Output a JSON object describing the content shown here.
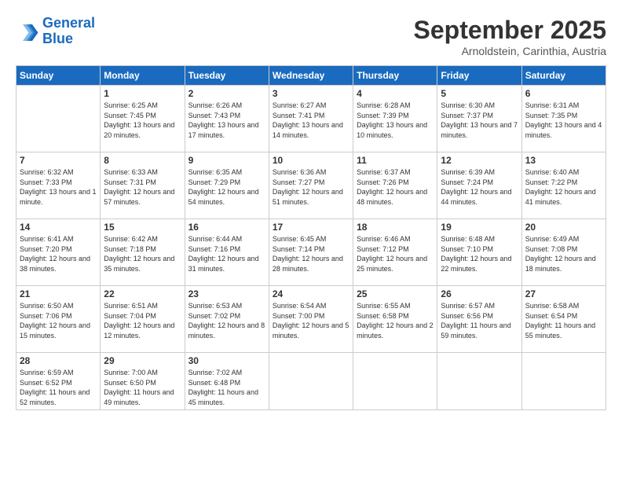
{
  "header": {
    "logo_line1": "General",
    "logo_line2": "Blue",
    "month": "September 2025",
    "location": "Arnoldstein, Carinthia, Austria"
  },
  "weekdays": [
    "Sunday",
    "Monday",
    "Tuesday",
    "Wednesday",
    "Thursday",
    "Friday",
    "Saturday"
  ],
  "weeks": [
    [
      {
        "day": "",
        "sunrise": "",
        "sunset": "",
        "daylight": ""
      },
      {
        "day": "1",
        "sunrise": "Sunrise: 6:25 AM",
        "sunset": "Sunset: 7:45 PM",
        "daylight": "Daylight: 13 hours and 20 minutes."
      },
      {
        "day": "2",
        "sunrise": "Sunrise: 6:26 AM",
        "sunset": "Sunset: 7:43 PM",
        "daylight": "Daylight: 13 hours and 17 minutes."
      },
      {
        "day": "3",
        "sunrise": "Sunrise: 6:27 AM",
        "sunset": "Sunset: 7:41 PM",
        "daylight": "Daylight: 13 hours and 14 minutes."
      },
      {
        "day": "4",
        "sunrise": "Sunrise: 6:28 AM",
        "sunset": "Sunset: 7:39 PM",
        "daylight": "Daylight: 13 hours and 10 minutes."
      },
      {
        "day": "5",
        "sunrise": "Sunrise: 6:30 AM",
        "sunset": "Sunset: 7:37 PM",
        "daylight": "Daylight: 13 hours and 7 minutes."
      },
      {
        "day": "6",
        "sunrise": "Sunrise: 6:31 AM",
        "sunset": "Sunset: 7:35 PM",
        "daylight": "Daylight: 13 hours and 4 minutes."
      }
    ],
    [
      {
        "day": "7",
        "sunrise": "Sunrise: 6:32 AM",
        "sunset": "Sunset: 7:33 PM",
        "daylight": "Daylight: 13 hours and 1 minute."
      },
      {
        "day": "8",
        "sunrise": "Sunrise: 6:33 AM",
        "sunset": "Sunset: 7:31 PM",
        "daylight": "Daylight: 12 hours and 57 minutes."
      },
      {
        "day": "9",
        "sunrise": "Sunrise: 6:35 AM",
        "sunset": "Sunset: 7:29 PM",
        "daylight": "Daylight: 12 hours and 54 minutes."
      },
      {
        "day": "10",
        "sunrise": "Sunrise: 6:36 AM",
        "sunset": "Sunset: 7:27 PM",
        "daylight": "Daylight: 12 hours and 51 minutes."
      },
      {
        "day": "11",
        "sunrise": "Sunrise: 6:37 AM",
        "sunset": "Sunset: 7:26 PM",
        "daylight": "Daylight: 12 hours and 48 minutes."
      },
      {
        "day": "12",
        "sunrise": "Sunrise: 6:39 AM",
        "sunset": "Sunset: 7:24 PM",
        "daylight": "Daylight: 12 hours and 44 minutes."
      },
      {
        "day": "13",
        "sunrise": "Sunrise: 6:40 AM",
        "sunset": "Sunset: 7:22 PM",
        "daylight": "Daylight: 12 hours and 41 minutes."
      }
    ],
    [
      {
        "day": "14",
        "sunrise": "Sunrise: 6:41 AM",
        "sunset": "Sunset: 7:20 PM",
        "daylight": "Daylight: 12 hours and 38 minutes."
      },
      {
        "day": "15",
        "sunrise": "Sunrise: 6:42 AM",
        "sunset": "Sunset: 7:18 PM",
        "daylight": "Daylight: 12 hours and 35 minutes."
      },
      {
        "day": "16",
        "sunrise": "Sunrise: 6:44 AM",
        "sunset": "Sunset: 7:16 PM",
        "daylight": "Daylight: 12 hours and 31 minutes."
      },
      {
        "day": "17",
        "sunrise": "Sunrise: 6:45 AM",
        "sunset": "Sunset: 7:14 PM",
        "daylight": "Daylight: 12 hours and 28 minutes."
      },
      {
        "day": "18",
        "sunrise": "Sunrise: 6:46 AM",
        "sunset": "Sunset: 7:12 PM",
        "daylight": "Daylight: 12 hours and 25 minutes."
      },
      {
        "day": "19",
        "sunrise": "Sunrise: 6:48 AM",
        "sunset": "Sunset: 7:10 PM",
        "daylight": "Daylight: 12 hours and 22 minutes."
      },
      {
        "day": "20",
        "sunrise": "Sunrise: 6:49 AM",
        "sunset": "Sunset: 7:08 PM",
        "daylight": "Daylight: 12 hours and 18 minutes."
      }
    ],
    [
      {
        "day": "21",
        "sunrise": "Sunrise: 6:50 AM",
        "sunset": "Sunset: 7:06 PM",
        "daylight": "Daylight: 12 hours and 15 minutes."
      },
      {
        "day": "22",
        "sunrise": "Sunrise: 6:51 AM",
        "sunset": "Sunset: 7:04 PM",
        "daylight": "Daylight: 12 hours and 12 minutes."
      },
      {
        "day": "23",
        "sunrise": "Sunrise: 6:53 AM",
        "sunset": "Sunset: 7:02 PM",
        "daylight": "Daylight: 12 hours and 8 minutes."
      },
      {
        "day": "24",
        "sunrise": "Sunrise: 6:54 AM",
        "sunset": "Sunset: 7:00 PM",
        "daylight": "Daylight: 12 hours and 5 minutes."
      },
      {
        "day": "25",
        "sunrise": "Sunrise: 6:55 AM",
        "sunset": "Sunset: 6:58 PM",
        "daylight": "Daylight: 12 hours and 2 minutes."
      },
      {
        "day": "26",
        "sunrise": "Sunrise: 6:57 AM",
        "sunset": "Sunset: 6:56 PM",
        "daylight": "Daylight: 11 hours and 59 minutes."
      },
      {
        "day": "27",
        "sunrise": "Sunrise: 6:58 AM",
        "sunset": "Sunset: 6:54 PM",
        "daylight": "Daylight: 11 hours and 55 minutes."
      }
    ],
    [
      {
        "day": "28",
        "sunrise": "Sunrise: 6:59 AM",
        "sunset": "Sunset: 6:52 PM",
        "daylight": "Daylight: 11 hours and 52 minutes."
      },
      {
        "day": "29",
        "sunrise": "Sunrise: 7:00 AM",
        "sunset": "Sunset: 6:50 PM",
        "daylight": "Daylight: 11 hours and 49 minutes."
      },
      {
        "day": "30",
        "sunrise": "Sunrise: 7:02 AM",
        "sunset": "Sunset: 6:48 PM",
        "daylight": "Daylight: 11 hours and 45 minutes."
      },
      {
        "day": "",
        "sunrise": "",
        "sunset": "",
        "daylight": ""
      },
      {
        "day": "",
        "sunrise": "",
        "sunset": "",
        "daylight": ""
      },
      {
        "day": "",
        "sunrise": "",
        "sunset": "",
        "daylight": ""
      },
      {
        "day": "",
        "sunrise": "",
        "sunset": "",
        "daylight": ""
      }
    ]
  ]
}
